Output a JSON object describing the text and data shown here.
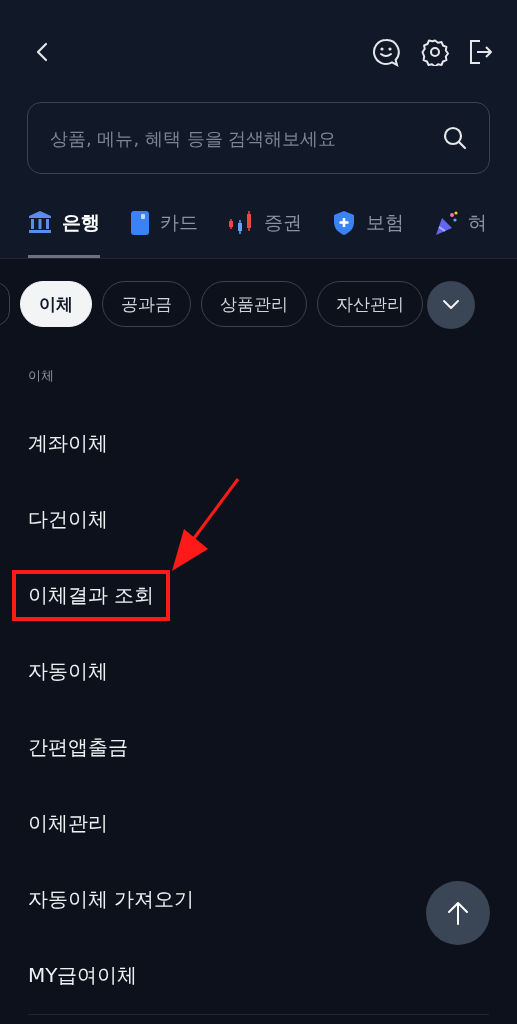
{
  "search": {
    "placeholder": "상품, 메뉴, 혜택 등을 검색해보세요"
  },
  "tabs": [
    {
      "label": "은행",
      "kind": "bank",
      "selected": true
    },
    {
      "label": "카드",
      "kind": "card",
      "selected": false
    },
    {
      "label": "증권",
      "kind": "stock",
      "selected": false
    },
    {
      "label": "보험",
      "kind": "insurance",
      "selected": false
    },
    {
      "label": "혀",
      "kind": "benefit",
      "selected": false
    }
  ],
  "chips": [
    {
      "label": "이체",
      "selected": true
    },
    {
      "label": "공과금",
      "selected": false
    },
    {
      "label": "상품관리",
      "selected": false
    },
    {
      "label": "자산관리",
      "selected": false
    }
  ],
  "section": {
    "title": "이체"
  },
  "menu_items": [
    {
      "label": "계좌이체",
      "highlighted": false
    },
    {
      "label": "다건이체",
      "highlighted": false
    },
    {
      "label": "이체결과 조회",
      "highlighted": true
    },
    {
      "label": "자동이체",
      "highlighted": false
    },
    {
      "label": "간편앱출금",
      "highlighted": false
    },
    {
      "label": "이체관리",
      "highlighted": false
    },
    {
      "label": "자동이체 가져오기",
      "highlighted": false
    },
    {
      "label": "MY급여이체",
      "highlighted": false
    }
  ]
}
